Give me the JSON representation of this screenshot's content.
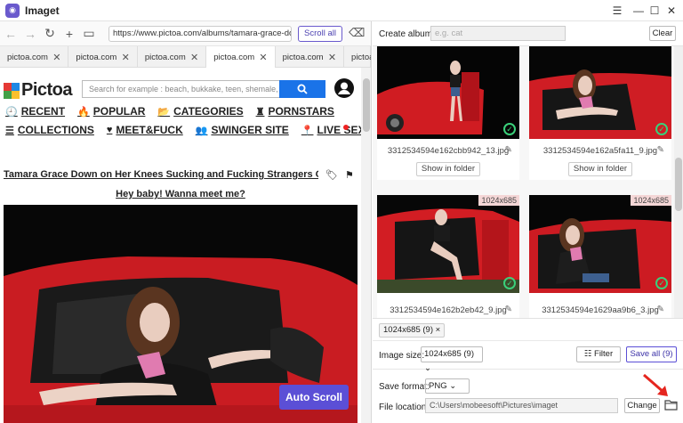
{
  "window": {
    "title": "Imaget"
  },
  "browser": {
    "url": "https://www.pictoa.com/albums/tamara-grace-dow",
    "scroll_all_label": "Scroll all",
    "tabs": [
      {
        "label": "pictoa.com"
      },
      {
        "label": "pictoa.com"
      },
      {
        "label": "pictoa.com"
      },
      {
        "label": "pictoa.com"
      },
      {
        "label": "pictoa.com"
      },
      {
        "label": "pictoa"
      }
    ]
  },
  "site": {
    "logo": "Pictoa",
    "search_placeholder": "Search for example : beach, bukkake, teen, shemale, m",
    "menu_row1": [
      "RECENT",
      "POPULAR",
      "CATEGORIES",
      "PORNSTARS"
    ],
    "menu_row2": [
      "COLLECTIONS",
      "MEET&FUCK",
      "SWINGER SITE",
      "LIVE SEX"
    ],
    "album_title": "Tamara Grace Down on Her Knees Sucking and Fucking Strangers Outdoo",
    "greeting": "Hey baby! Wanna meet me?",
    "auto_scroll_label": "Auto Scroll"
  },
  "panel": {
    "create_album_label": "Create album:",
    "create_album_placeholder": "e.g. cat",
    "clear_label": "Clear",
    "images": [
      {
        "filename": "3312534594e162cbb942_13.jpg",
        "size": "",
        "show_label": "Show in folder"
      },
      {
        "filename": "3312534594e162a5fa11_9.jpg",
        "size": "",
        "show_label": "Show in folder"
      },
      {
        "filename": "3312534594e162b2eb42_9.jpg",
        "size": "1024x685"
      },
      {
        "filename": "3312534594e1629aa9b6_3.jpg",
        "size": "1024x685"
      }
    ],
    "chip_label": "1024x685 (9)",
    "chip_close": "×",
    "image_size_label": "Image size:",
    "image_size_value": "1024x685 (9)",
    "filter_label": "Filter",
    "save_all_label": "Save all (9)",
    "save_format_label": "Save format:",
    "save_format_value": "PNG",
    "file_location_label": "File location:",
    "file_location_value": "C:\\Users\\mobeesoft\\Pictures\\imaget",
    "change_label": "Change"
  },
  "colors": {
    "accent": "#5b4fd6",
    "car_red": "#d81f26",
    "check_green": "#3ad07a"
  }
}
